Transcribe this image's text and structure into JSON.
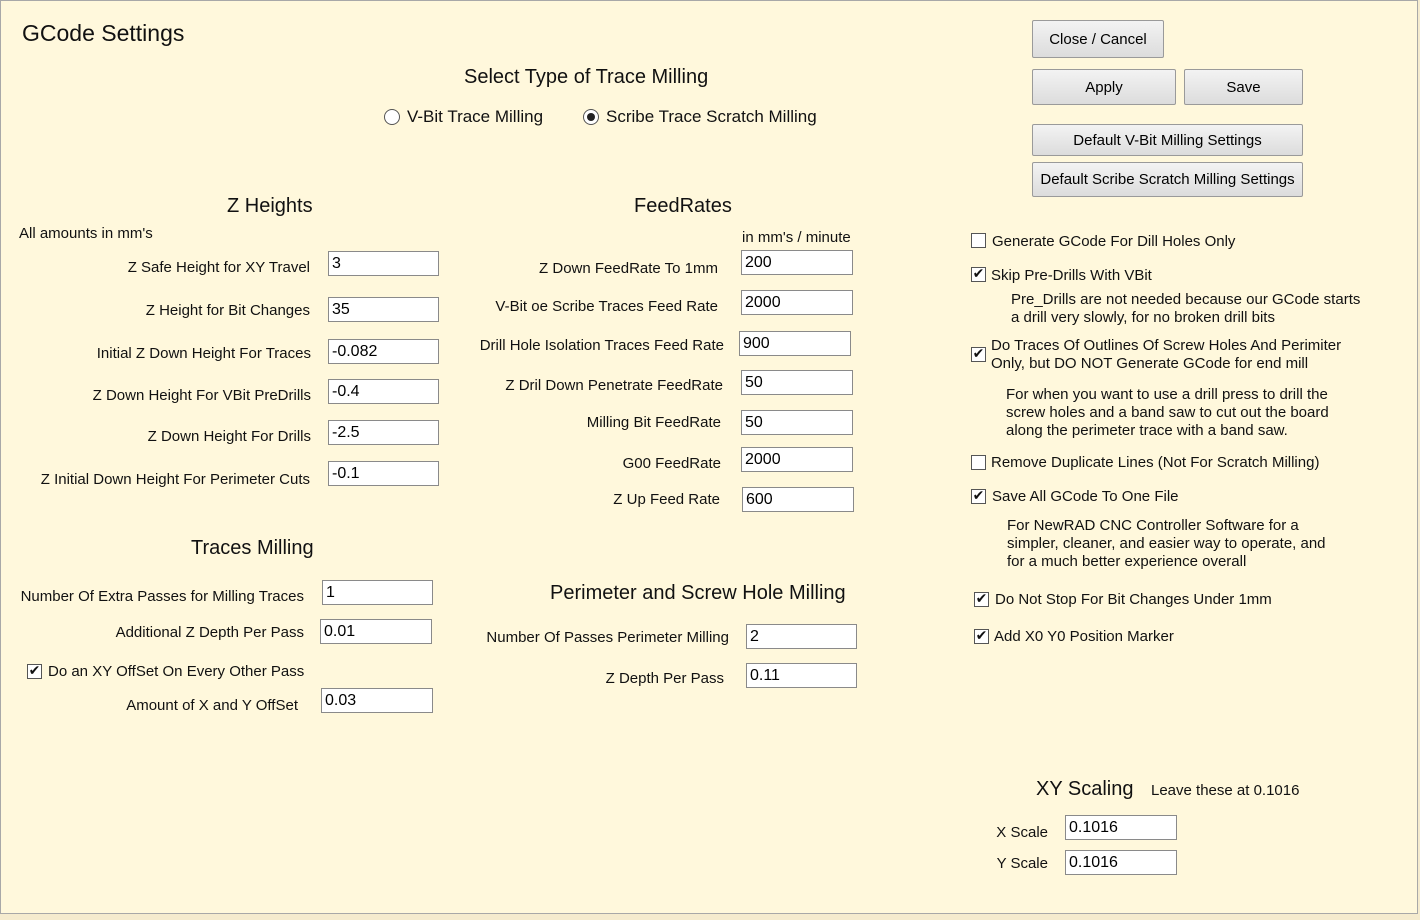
{
  "window": {
    "title": "GCode Settings"
  },
  "buttons": {
    "close": "Close / Cancel",
    "apply": "Apply",
    "save": "Save",
    "default_vbit": "Default V-Bit Milling Settings",
    "default_scribe": "Default Scribe Scratch Milling Settings"
  },
  "milling_type": {
    "heading": "Select Type of Trace Milling",
    "options": [
      {
        "label": "V-Bit Trace Milling",
        "selected": false
      },
      {
        "label": "Scribe Trace Scratch Milling",
        "selected": true
      }
    ]
  },
  "z_heights": {
    "heading": "Z Heights",
    "note": "All amounts in mm's",
    "fields": [
      {
        "label": "Z Safe Height for XY Travel",
        "value": "3"
      },
      {
        "label": "Z Height for Bit Changes",
        "value": "35"
      },
      {
        "label": "Initial Z Down Height For Traces",
        "value": "-0.082"
      },
      {
        "label": "Z Down Height For VBit PreDrills",
        "value": "-0.4"
      },
      {
        "label": "Z Down Height For Drills",
        "value": "-2.5"
      },
      {
        "label": "Z Initial Down Height For Perimeter Cuts",
        "value": "-0.1"
      }
    ]
  },
  "feedrates": {
    "heading": "FeedRates",
    "units": "in mm's / minute",
    "fields": [
      {
        "label": "Z Down FeedRate To 1mm",
        "value": "200"
      },
      {
        "label": "V-Bit oe Scribe Traces Feed Rate",
        "value": "2000"
      },
      {
        "label": "Drill Hole Isolation Traces Feed Rate",
        "value": "900"
      },
      {
        "label": "Z Dril Down Penetrate FeedRate",
        "value": "50"
      },
      {
        "label": "Milling Bit FeedRate",
        "value": "50"
      },
      {
        "label": "G00 FeedRate",
        "value": "2000"
      },
      {
        "label": "Z Up Feed Rate",
        "value": "600"
      }
    ]
  },
  "traces_milling": {
    "heading": "Traces Milling",
    "extra_passes": {
      "label": "Number Of Extra Passes for Milling Traces",
      "value": "1"
    },
    "z_depth": {
      "label": "Additional Z Depth Per Pass",
      "value": "0.01"
    },
    "xy_offset_check": {
      "label": "Do an XY OffSet On Every Other Pass",
      "checked": true
    },
    "xy_offset_amount": {
      "label": "Amount of X and Y OffSet",
      "value": "0.03"
    }
  },
  "perimeter": {
    "heading": "Perimeter and Screw Hole Milling",
    "passes": {
      "label": "Number Of Passes Perimeter Milling",
      "value": "2"
    },
    "z_depth": {
      "label": "Z Depth Per Pass",
      "value": "0.11"
    }
  },
  "options": {
    "drill_only": {
      "label": "Generate GCode For Dill Holes Only",
      "checked": false
    },
    "skip_predrills": {
      "label": "Skip Pre-Drills With VBit",
      "checked": true,
      "note": "Pre_Drills are not needed because our GCode starts a drill very slowly, for no broken drill bits"
    },
    "outlines_only": {
      "label": "Do Traces Of Outlines Of Screw Holes And Perimiter Only, but DO NOT Generate GCode for end mill",
      "checked": true,
      "note": "For when you want to use a drill press to drill the screw holes and a band saw to cut out the board along the perimeter trace with a band saw."
    },
    "remove_duplicates": {
      "label": "Remove Duplicate Lines (Not For Scratch Milling)",
      "checked": false
    },
    "one_file": {
      "label": "Save All GCode To One File",
      "checked": true,
      "note": "For NewRAD CNC Controller Software for a simpler, cleaner, and easier way to operate, and for a much better experience overall"
    },
    "no_stop": {
      "label": "Do Not Stop For Bit Changes Under 1mm",
      "checked": true
    },
    "marker": {
      "label": "Add X0 Y0 Position Marker",
      "checked": true
    }
  },
  "xy_scaling": {
    "heading": "XY Scaling",
    "note": "Leave these at 0.1016",
    "x": {
      "label": "X Scale",
      "value": "0.1016"
    },
    "y": {
      "label": "Y Scale",
      "value": "0.1016"
    }
  }
}
